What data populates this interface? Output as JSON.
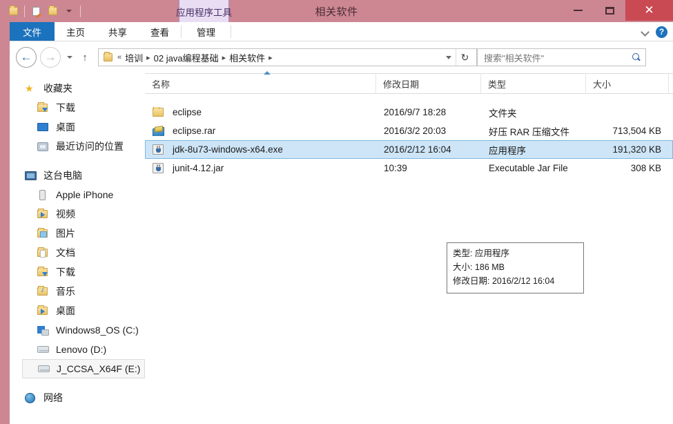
{
  "window": {
    "title": "相关软件",
    "accent_color": "#cc8793",
    "close_color": "#c94a52",
    "controls": {
      "minimize": "–",
      "maximize": "□",
      "close": "✕"
    }
  },
  "quick_access": {
    "system_menu_icon": "folder-icon",
    "properties_icon": "properties-icon",
    "new_folder_icon": "new-folder-icon",
    "customize_icon": "chevron-down-icon"
  },
  "ribbon": {
    "contextual_tab": "应用程序工具",
    "contextual_color": "#e8ddf3",
    "tabs": [
      {
        "label": "文件",
        "active": true
      },
      {
        "label": "主页",
        "active": false
      },
      {
        "label": "共享",
        "active": false
      },
      {
        "label": "查看",
        "active": false
      },
      {
        "label": "管理",
        "active": false
      }
    ],
    "collapse_icon": "chevron-down-icon",
    "help_label": "?"
  },
  "address_bar": {
    "back_icon": "←",
    "forward_icon": "→",
    "history_icon": "chevron-down-icon",
    "up_icon": "↑",
    "root_icon": "folder-icon",
    "overflow": "«",
    "separator": "▸",
    "crumbs": [
      "培训",
      "02 java编程基础",
      "相关软件"
    ],
    "dropdown_icon": "chevron-down-icon",
    "refresh_icon": "↻"
  },
  "search": {
    "placeholder": "搜索\"相关软件\"",
    "icon": "search-icon"
  },
  "sidebar": {
    "groups": [
      {
        "name": "favorites",
        "items": [
          {
            "label": "收藏夹",
            "icon": "star-icon",
            "level": 0
          },
          {
            "label": "下载",
            "icon": "downloads-folder-icon",
            "level": 1
          },
          {
            "label": "桌面",
            "icon": "desktop-icon",
            "level": 1
          },
          {
            "label": "最近访问的位置",
            "icon": "recent-places-icon",
            "level": 1
          }
        ]
      },
      {
        "name": "this-pc",
        "items": [
          {
            "label": "这台电脑",
            "icon": "computer-icon",
            "level": 0
          },
          {
            "label": "Apple iPhone",
            "icon": "phone-icon",
            "level": 1
          },
          {
            "label": "视频",
            "icon": "videos-folder-icon",
            "level": 1
          },
          {
            "label": "图片",
            "icon": "pictures-folder-icon",
            "level": 1
          },
          {
            "label": "文档",
            "icon": "documents-folder-icon",
            "level": 1
          },
          {
            "label": "下载",
            "icon": "downloads-folder-icon",
            "level": 1
          },
          {
            "label": "音乐",
            "icon": "music-folder-icon",
            "level": 1
          },
          {
            "label": "桌面",
            "icon": "desktop-folder-icon",
            "level": 1
          },
          {
            "label": "Windows8_OS (C:)",
            "icon": "windows-drive-icon",
            "level": 1
          },
          {
            "label": "Lenovo (D:)",
            "icon": "drive-icon",
            "level": 1
          },
          {
            "label": "J_CCSA_X64F (E:)",
            "icon": "drive-icon",
            "level": 1,
            "selected": true
          }
        ]
      },
      {
        "name": "network",
        "items": [
          {
            "label": "网络",
            "icon": "network-icon",
            "level": 0
          }
        ]
      }
    ]
  },
  "file_list": {
    "columns": [
      "名称",
      "修改日期",
      "类型",
      "大小"
    ],
    "sort_column": "名称",
    "sort_direction": "ascending",
    "selection_color": "#cde5f7",
    "rows": [
      {
        "name": "eclipse",
        "date": "2016/9/7 18:28",
        "type": "文件夹",
        "size": "",
        "icon": "folder-icon",
        "selected": false
      },
      {
        "name": "eclipse.rar",
        "date": "2016/3/2 20:03",
        "type": "好压 RAR 压缩文件",
        "size": "713,504 KB",
        "icon": "rar-archive-icon",
        "selected": false
      },
      {
        "name": "jdk-8u73-windows-x64.exe",
        "date": "2016/2/12 16:04",
        "type": "应用程序",
        "size": "191,320 KB",
        "icon": "java-executable-icon",
        "selected": true
      },
      {
        "name": "junit-4.12.jar",
        "date": "10:39",
        "type": "Executable Jar File",
        "size": "308 KB",
        "icon": "java-jar-icon",
        "selected": false
      }
    ]
  },
  "tooltip": {
    "type_line": "类型: 应用程序",
    "size_line": "大小: 186 MB",
    "date_line": "修改日期: 2016/2/12 16:04"
  }
}
